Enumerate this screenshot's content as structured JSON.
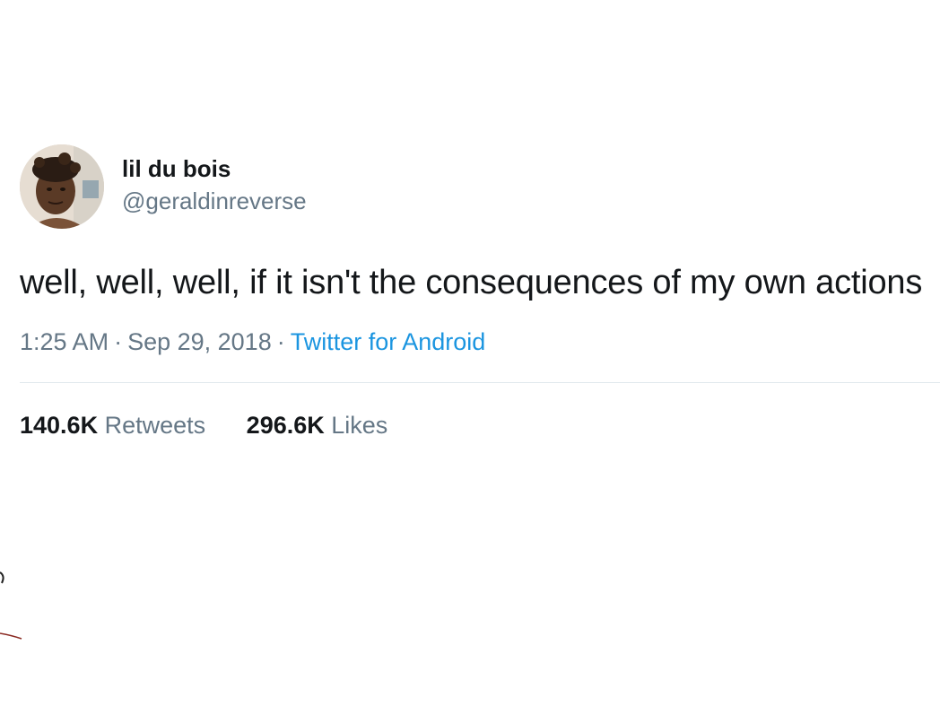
{
  "tweet": {
    "author": {
      "display_name": "lil du bois",
      "handle": "@geraldinreverse"
    },
    "text": "well, well, well, if it isn't the consequences of my own actions",
    "time": "1:25 AM",
    "date": "Sep 29, 2018",
    "separator": "·",
    "source": "Twitter for Android",
    "stats": {
      "retweets_count": "140.6K",
      "retweets_label": "Retweets",
      "likes_count": "296.6K",
      "likes_label": "Likes"
    }
  },
  "colors": {
    "text": "#14171a",
    "secondary": "#657786",
    "link": "#1b95e0",
    "divider": "#e1e8ed"
  }
}
